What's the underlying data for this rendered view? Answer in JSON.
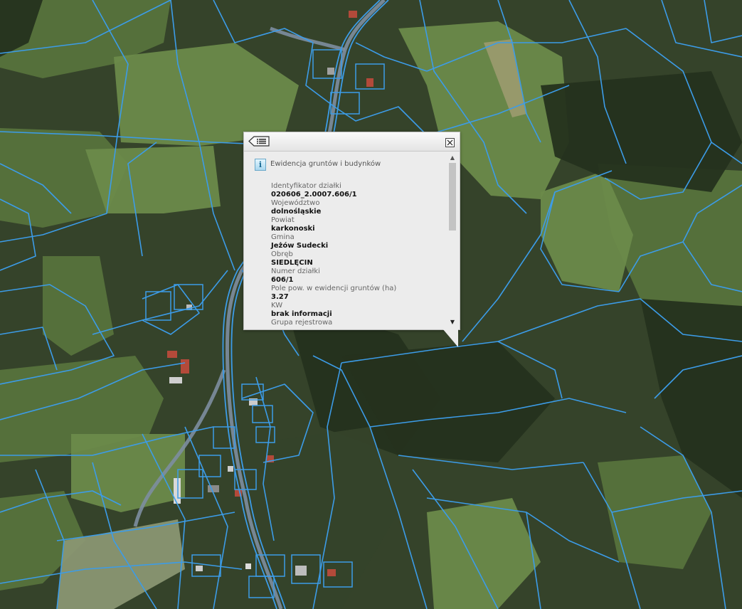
{
  "map": {
    "colors": {
      "parcel_line": "#3c9ce8",
      "forest_dark": "#25311d",
      "forest_mid": "#35432a",
      "meadow": "#57733c",
      "meadow_light": "#6b8a4a",
      "road": "#7d8ea0",
      "roof_red": "#b34a3a"
    }
  },
  "popup": {
    "back_icon": "list-back-icon",
    "close_icon": "close-icon",
    "layer_icon": "info-icon",
    "info_glyph": "i",
    "layer_title": "Ewidencja gruntów i budynków",
    "fields": [
      {
        "label": "Identyfikator działki",
        "value": "020606_2.0007.606/1"
      },
      {
        "label": "Województwo",
        "value": "dolnośląskie"
      },
      {
        "label": "Powiat",
        "value": "karkonoski"
      },
      {
        "label": "Gmina",
        "value": "Jeżów Sudecki"
      },
      {
        "label": "Obręb",
        "value": "SIEDLĘCIN"
      },
      {
        "label": "Numer działki",
        "value": "606/1"
      },
      {
        "label": "Pole pow. w ewidencji gruntów (ha)",
        "value": "3.27"
      },
      {
        "label": "KW",
        "value": "brak informacji"
      },
      {
        "label": "Grupa rejestrowa",
        "value": ""
      }
    ],
    "scroll": {
      "up_glyph": "▲",
      "down_glyph": "▼",
      "position_fraction": 0
    }
  }
}
